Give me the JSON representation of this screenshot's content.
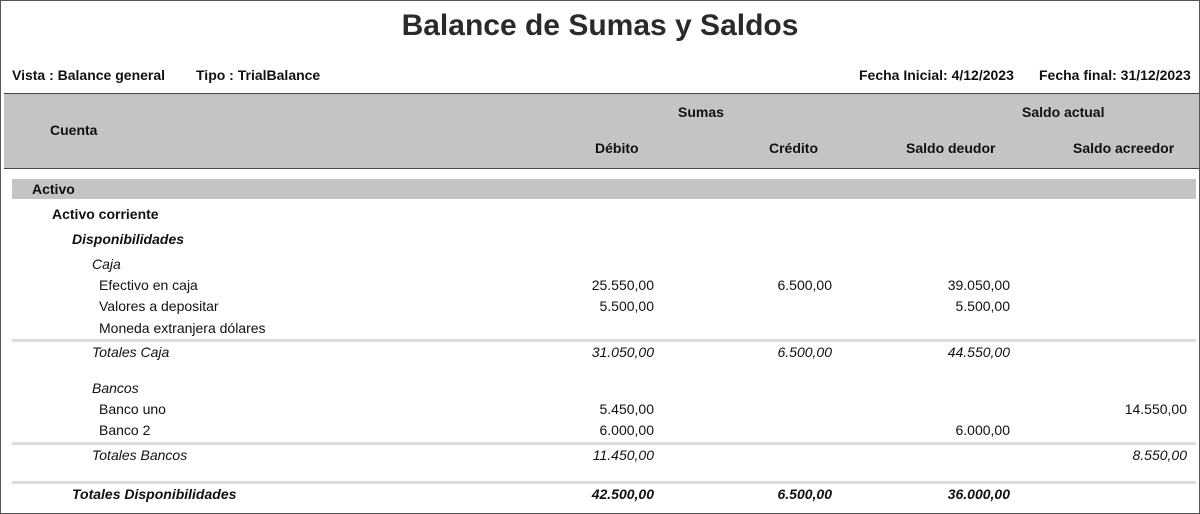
{
  "report": {
    "title": "Balance de Sumas y Saldos",
    "vista": "Vista : Balance general",
    "tipo": "Tipo : TrialBalance",
    "fecha_inicial": "Fecha Inicial: 4/12/2023",
    "fecha_final": "Fecha final: 31/12/2023"
  },
  "header": {
    "cuenta": "Cuenta",
    "sumas": "Sumas",
    "saldo_actual": "Saldo actual",
    "debito": "Débito",
    "credito": "Crédito",
    "saldo_deudor": "Saldo deudor",
    "saldo_acreedor": "Saldo acreedor"
  },
  "rows": {
    "activo": "Activo",
    "activo_corriente": "Activo corriente",
    "disponibilidades": "Disponibilidades",
    "caja": "Caja",
    "efectivo": {
      "label": "Efectivo en caja",
      "debito": "25.550,00",
      "credito": "6.500,00",
      "deudor": "39.050,00",
      "acreedor": ""
    },
    "valores": {
      "label": "Valores a depositar",
      "debito": "5.500,00",
      "credito": "",
      "deudor": "5.500,00",
      "acreedor": ""
    },
    "moneda": {
      "label": "Moneda extranjera dólares",
      "debito": "",
      "credito": "",
      "deudor": "",
      "acreedor": ""
    },
    "totales_caja": {
      "label": "Totales Caja",
      "debito": "31.050,00",
      "credito": "6.500,00",
      "deudor": "44.550,00",
      "acreedor": ""
    },
    "bancos": "Bancos",
    "banco_uno": {
      "label": "Banco uno",
      "debito": "5.450,00",
      "credito": "",
      "deudor": "",
      "acreedor": "14.550,00"
    },
    "banco_2": {
      "label": "Banco 2",
      "debito": "6.000,00",
      "credito": "",
      "deudor": "6.000,00",
      "acreedor": ""
    },
    "totales_bancos": {
      "label": "Totales Bancos",
      "debito": "11.450,00",
      "credito": "",
      "deudor": "",
      "acreedor": "8.550,00"
    },
    "totales_disp": {
      "label": "Totales Disponibilidades",
      "debito": "42.500,00",
      "credito": "6.500,00",
      "deudor": "36.000,00",
      "acreedor": ""
    }
  }
}
